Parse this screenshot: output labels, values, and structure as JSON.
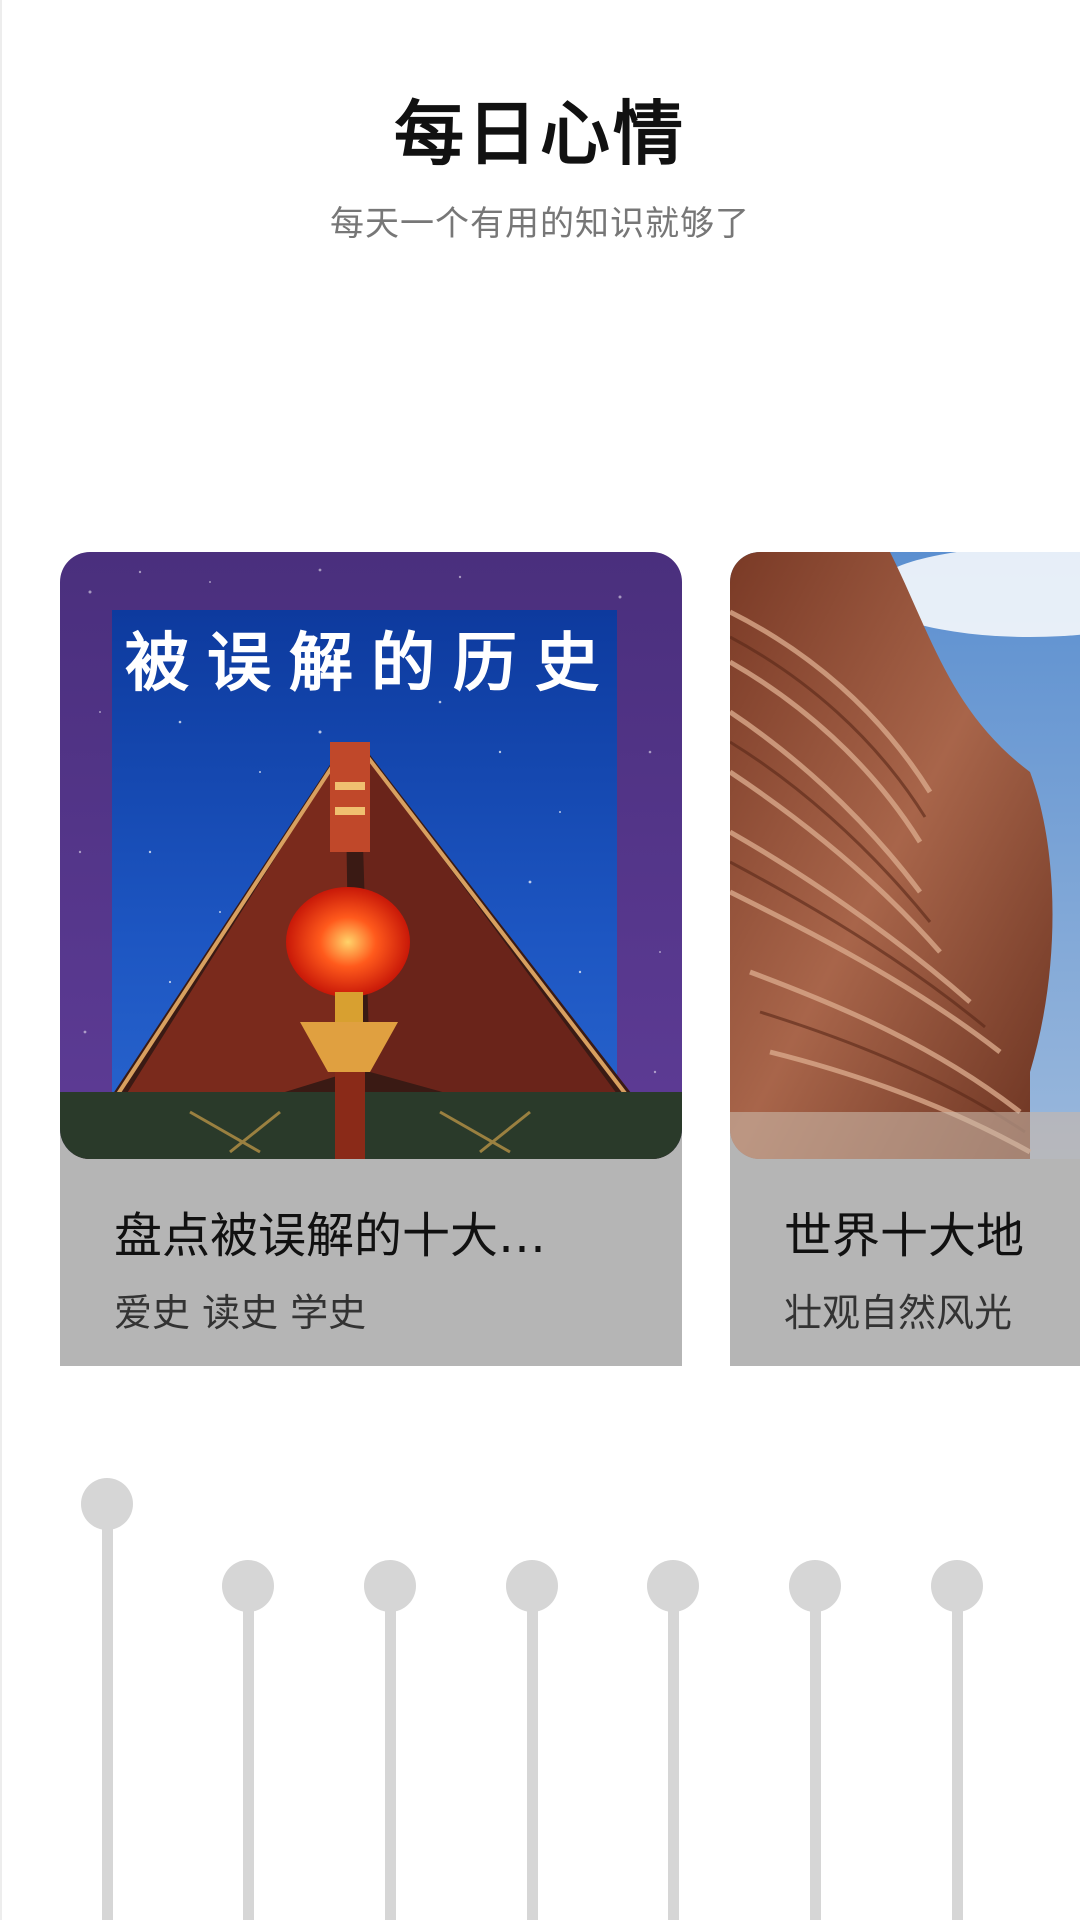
{
  "header": {
    "title": "每日心情",
    "subtitle": "每天一个有用的知识就够了"
  },
  "cards": [
    {
      "cover_caption": "被误解的历史",
      "title": "盘点被误解的十大…",
      "tags": "爱史 读史 学史"
    },
    {
      "title": "世界十大地",
      "tags": "壮观自然风光"
    }
  ],
  "sliders": {
    "count": 7,
    "levels": [
      0.92,
      0.75,
      0.75,
      0.75,
      0.75,
      0.75,
      0.75
    ],
    "color": "#d6d6d6"
  },
  "colors": {
    "card_info_bg": "#b5b5b5",
    "cover_purple": "#5a3d8f",
    "cover_blue": "#1e4db5",
    "rock_brown": "#9a5a3e"
  }
}
